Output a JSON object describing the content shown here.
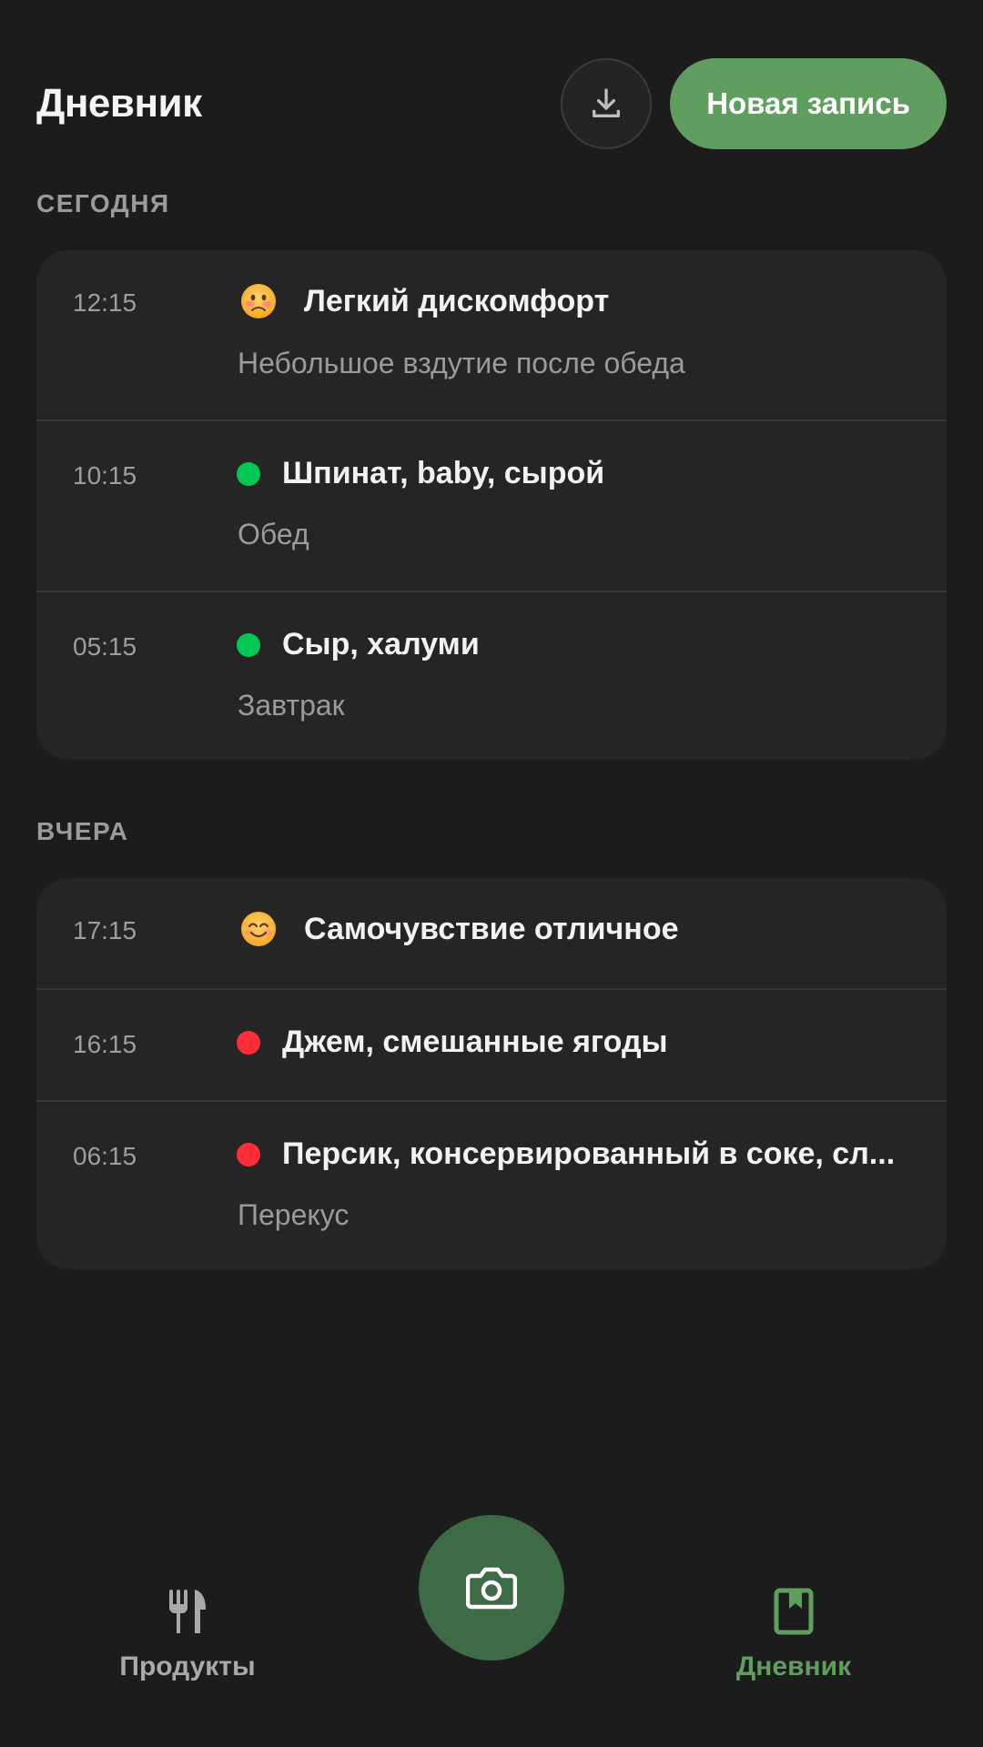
{
  "header": {
    "title": "Дневник",
    "download_icon": "download-icon",
    "new_entry_label": "Новая запись"
  },
  "colors": {
    "accent": "#5f9e5f",
    "fab": "#3d6b45",
    "good": "#00c853",
    "bad": "#ff2d3a",
    "background": "#1b1c1b",
    "card": "#242524"
  },
  "sections": [
    {
      "label": "СЕГОДНЯ",
      "entries": [
        {
          "time": "12:15",
          "marker": "worried-face-emoji",
          "title": "Легкий дискомфорт",
          "subtitle": "Небольшое вздутие после обеда"
        },
        {
          "time": "10:15",
          "marker": "green-dot",
          "title": "Шпинат, baby, сырой",
          "subtitle": "Обед"
        },
        {
          "time": "05:15",
          "marker": "green-dot",
          "title": "Сыр, халуми",
          "subtitle": "Завтрак"
        }
      ]
    },
    {
      "label": "ВЧЕРА",
      "entries": [
        {
          "time": "17:15",
          "marker": "smiling-face-emoji",
          "title": "Самочувствие отличное"
        },
        {
          "time": "16:15",
          "marker": "red-dot",
          "title": "Джем, смешанные ягоды"
        },
        {
          "time": "06:15",
          "marker": "red-dot",
          "title": "Персик, консервированный в соке, сл...",
          "subtitle": "Перекус"
        }
      ]
    }
  ],
  "bottom_nav": {
    "products_label": "Продукты",
    "products_icon": "fork-knife-icon",
    "camera_icon": "camera-icon",
    "diary_label": "Дневник",
    "diary_icon": "bookmark-book-icon",
    "active": "diary"
  }
}
